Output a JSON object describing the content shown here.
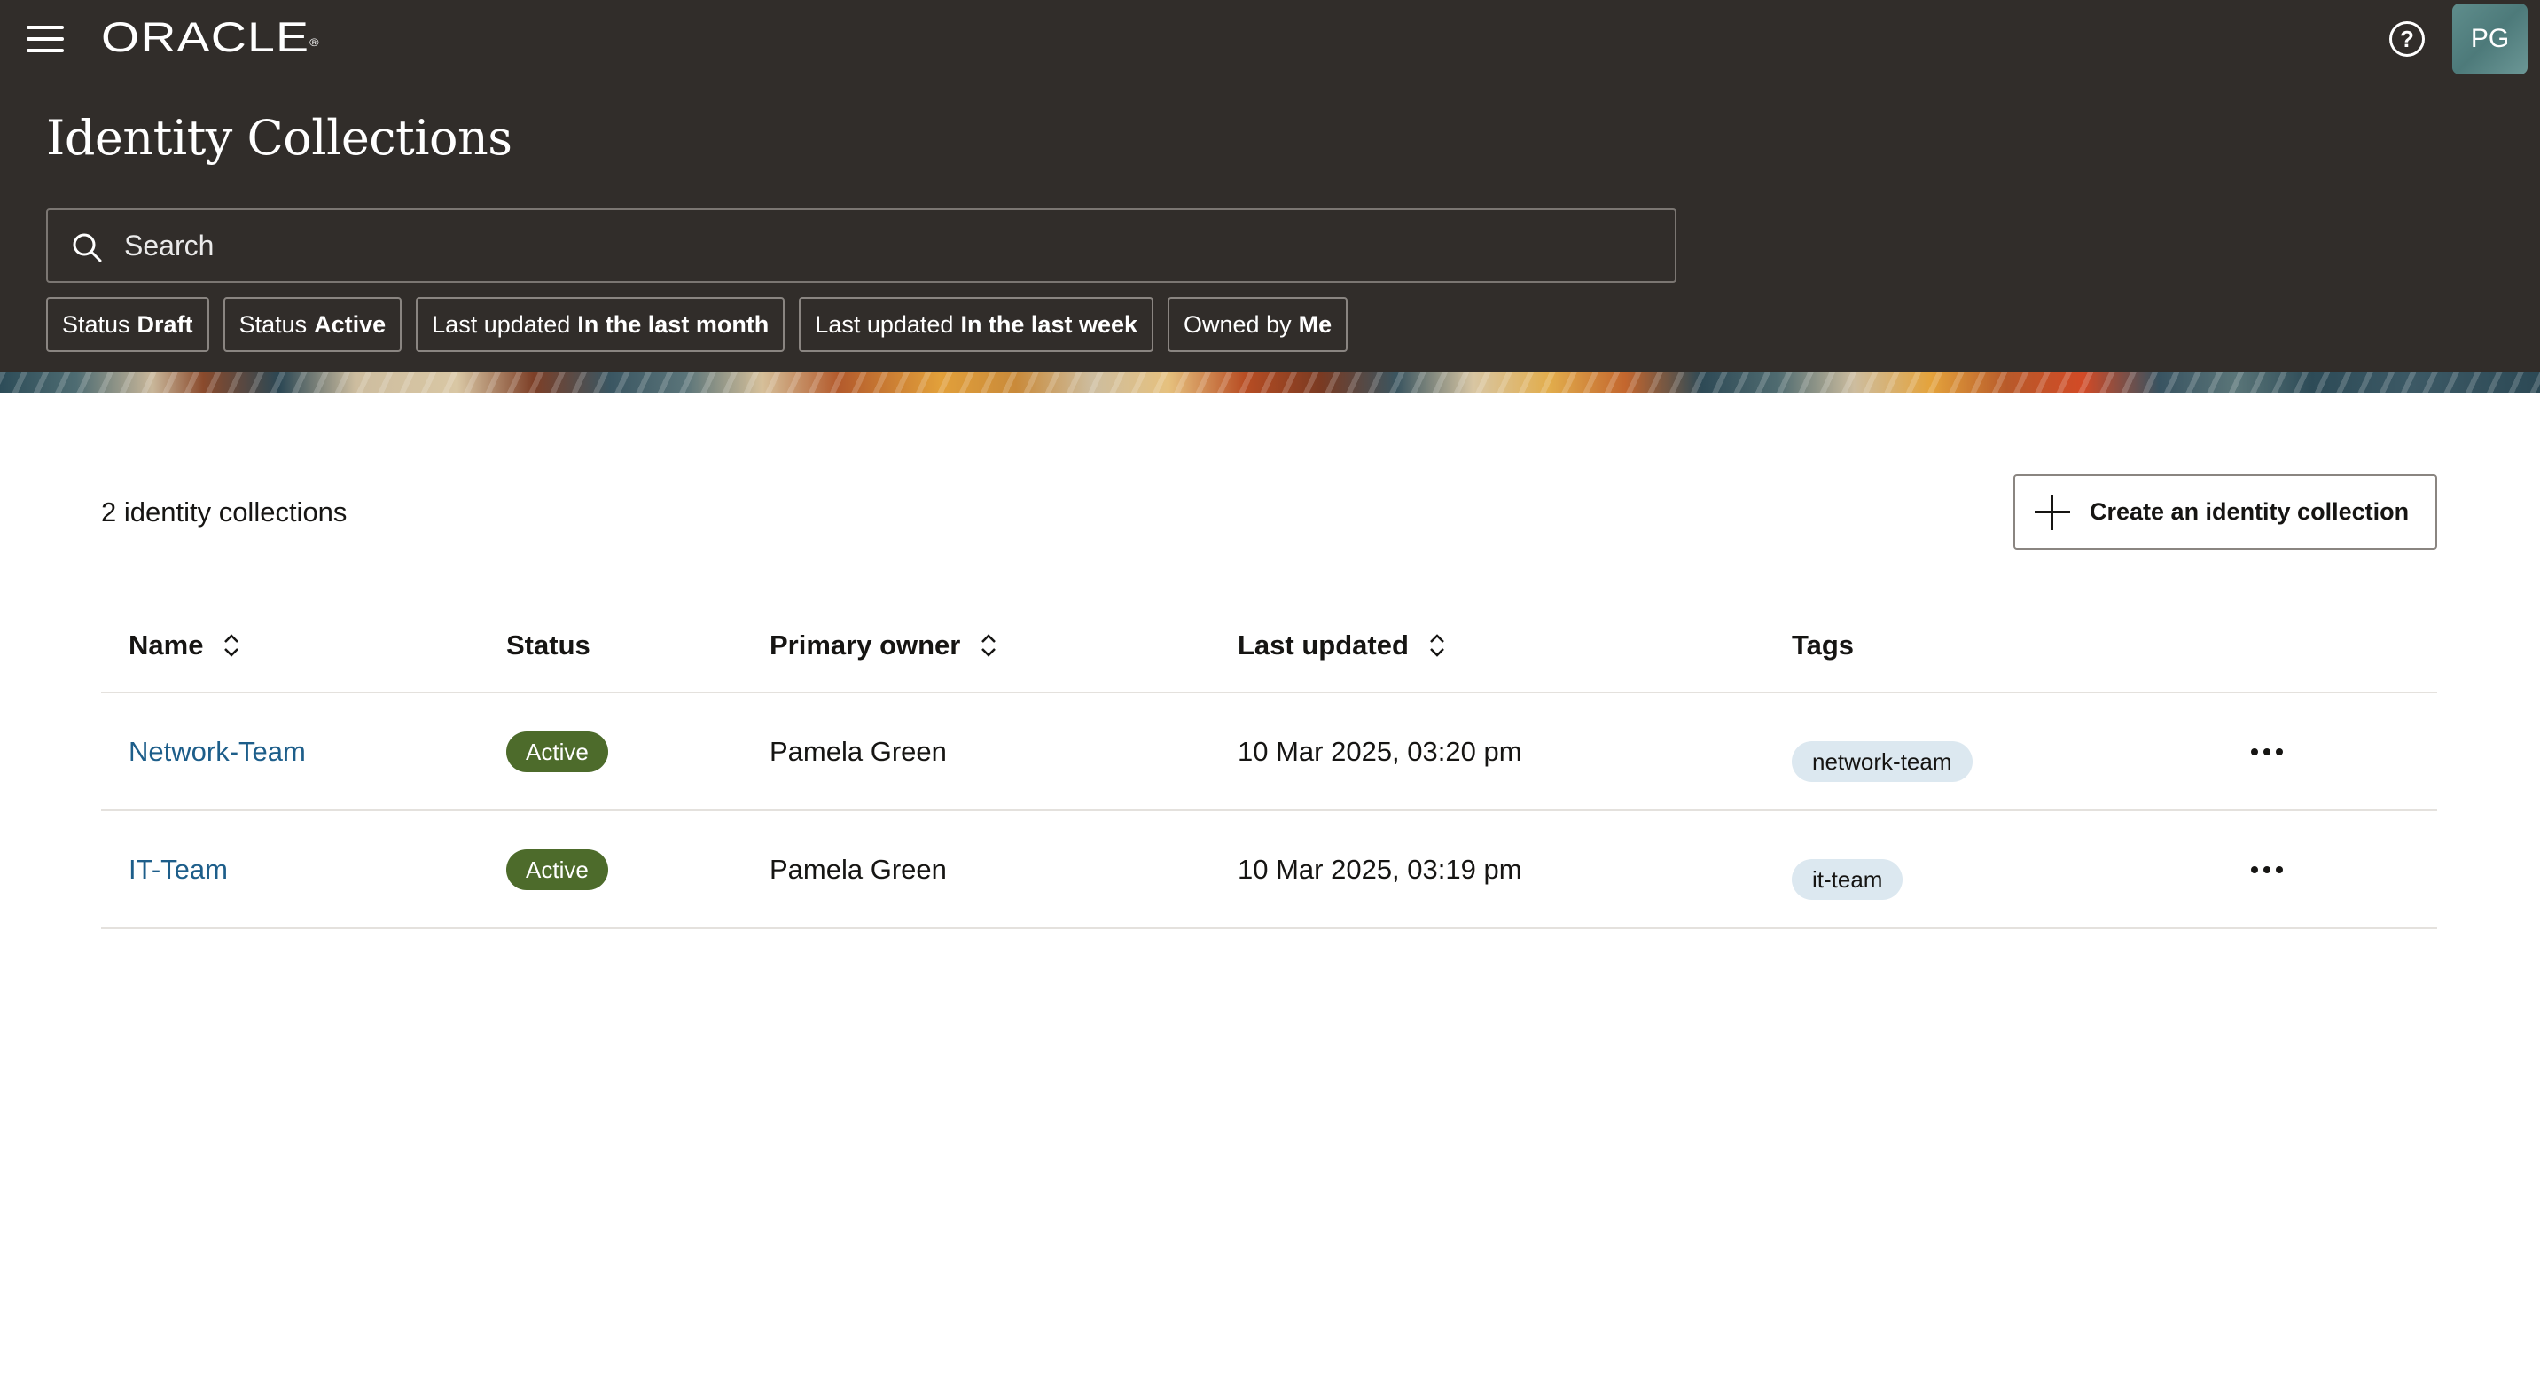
{
  "header": {
    "brand": "ORACLE",
    "brand_mark": "®",
    "title": "Identity Collections",
    "user_initials": "PG",
    "help_glyph": "?",
    "icons": {
      "menu": "hamburger-menu-icon",
      "help": "help-icon",
      "search": "search-icon"
    }
  },
  "search": {
    "placeholder": "Search",
    "value": ""
  },
  "filters": [
    {
      "label": "Status",
      "value": "Draft"
    },
    {
      "label": "Status",
      "value": "Active"
    },
    {
      "label": "Last updated",
      "value": "In the last month"
    },
    {
      "label": "Last updated",
      "value": "In the last week"
    },
    {
      "label": "Owned by",
      "value": "Me"
    }
  ],
  "main": {
    "count_text": "2 identity collections",
    "create_button": "Create an identity collection"
  },
  "table": {
    "columns": [
      "Name",
      "Status",
      "Primary owner",
      "Last updated",
      "Tags"
    ],
    "rows": [
      {
        "name": "Network-Team",
        "status": "Active",
        "owner": "Pamela Green",
        "updated": "10 Mar 2025, 03:20 pm",
        "tag": "network-team"
      },
      {
        "name": "IT-Team",
        "status": "Active",
        "owner": "Pamela Green",
        "updated": "10 Mar 2025, 03:19 pm",
        "tag": "it-team"
      }
    ]
  },
  "colors": {
    "header_bg": "#312d2a",
    "link": "#1d5e8a",
    "status_active": "#4d6b2b",
    "tag_bg": "#dce8f0"
  }
}
